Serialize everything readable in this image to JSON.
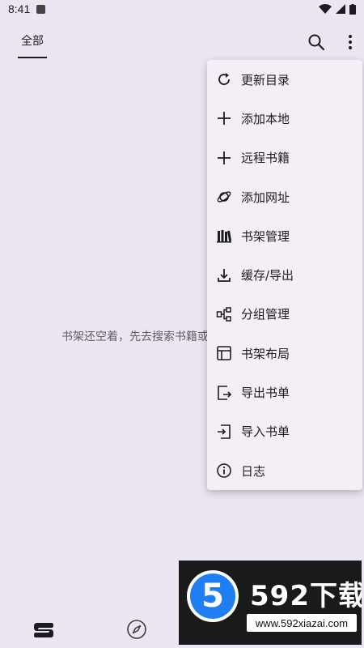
{
  "status": {
    "time": "8:41"
  },
  "header": {
    "tab_label": "全部"
  },
  "empty_state": {
    "text": "书架还空着，先去搜索书籍或"
  },
  "menu": {
    "items": [
      {
        "label": "更新目录",
        "icon": "refresh-icon"
      },
      {
        "label": "添加本地",
        "icon": "plus-icon"
      },
      {
        "label": "远程书籍",
        "icon": "plus-icon"
      },
      {
        "label": "添加网址",
        "icon": "planet-icon"
      },
      {
        "label": "书架管理",
        "icon": "books-icon"
      },
      {
        "label": "缓存/导出",
        "icon": "download-icon"
      },
      {
        "label": "分组管理",
        "icon": "group-icon"
      },
      {
        "label": "书架布局",
        "icon": "layout-icon"
      },
      {
        "label": "导出书单",
        "icon": "export-icon"
      },
      {
        "label": "导入书单",
        "icon": "import-icon"
      },
      {
        "label": "日志",
        "icon": "info-icon"
      }
    ]
  },
  "watermark": {
    "logo_text": "5",
    "title": "592下载",
    "url": "www.592xiazai.com"
  }
}
